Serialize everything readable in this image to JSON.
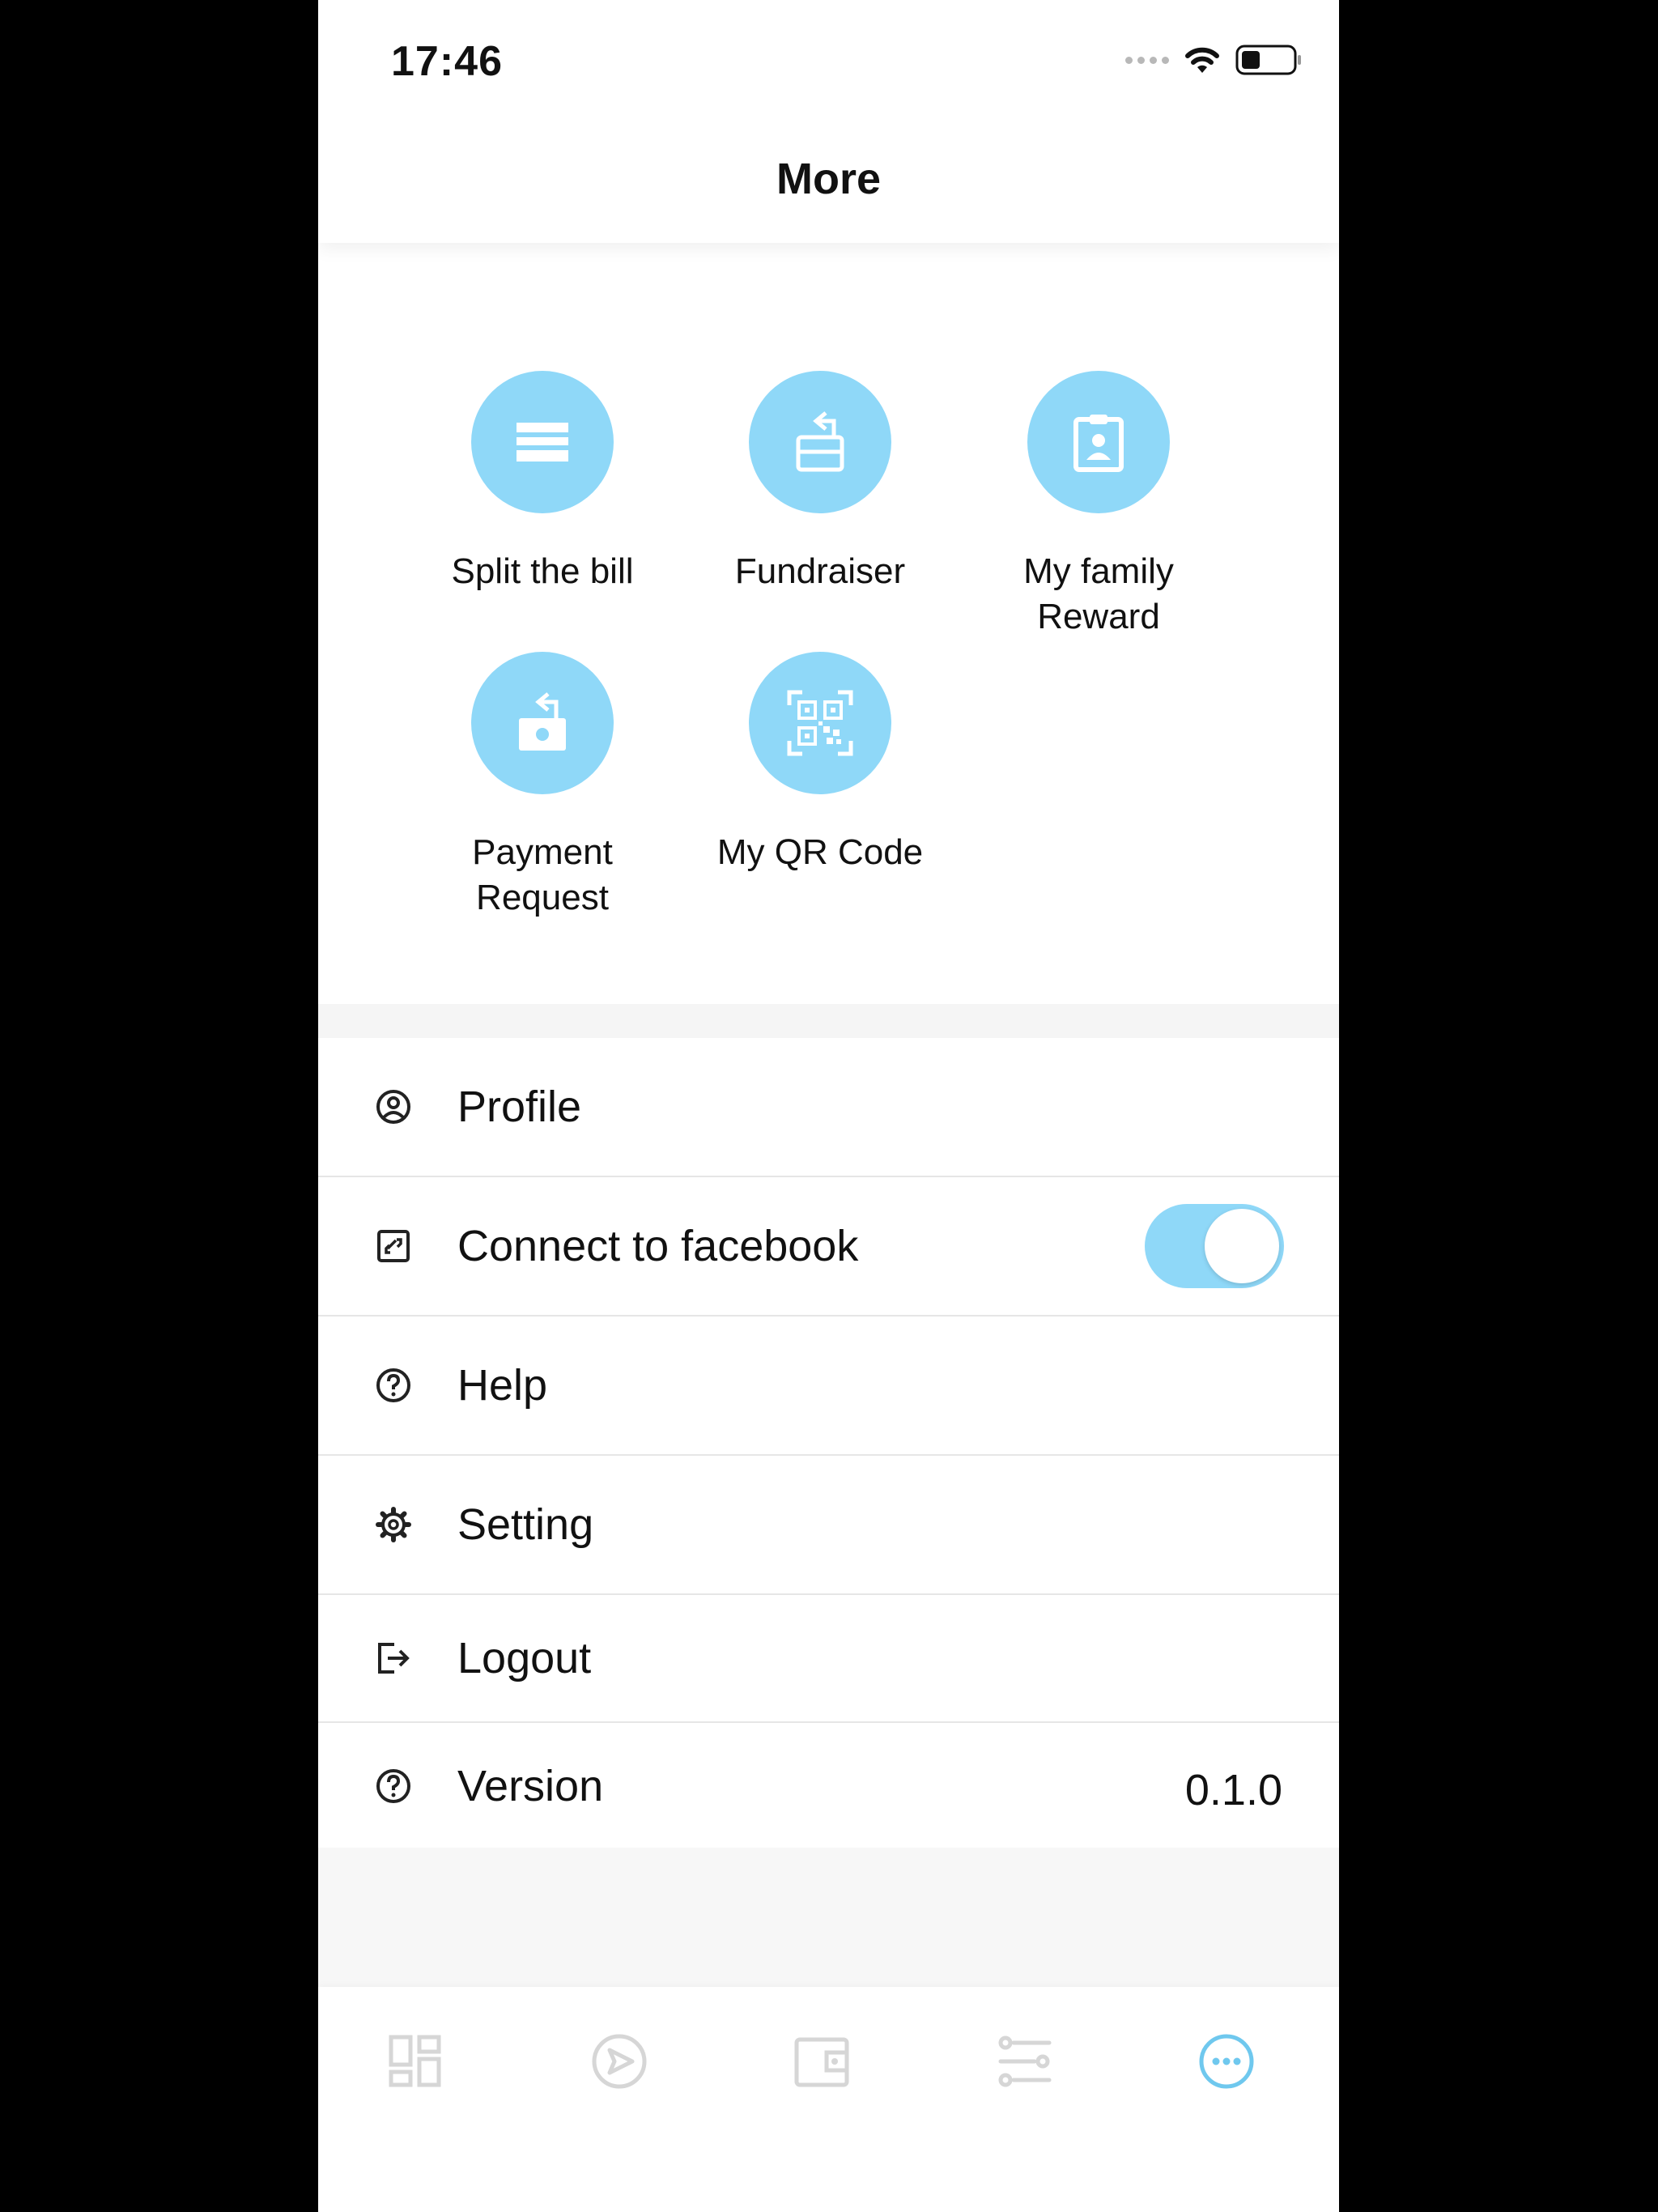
{
  "status_bar": {
    "time": "17:46"
  },
  "header": {
    "title": "More"
  },
  "features": [
    {
      "label": "Split the bill",
      "icon": "card-icon"
    },
    {
      "label": "Fundraiser",
      "icon": "wallet-return-icon"
    },
    {
      "label": "My family\nReward",
      "icon": "id-badge-icon"
    },
    {
      "label": "Payment\nRequest",
      "icon": "cash-return-icon"
    },
    {
      "label": "My QR Code",
      "icon": "qr-code-icon"
    }
  ],
  "settings": {
    "profile": "Profile",
    "facebook": "Connect to facebook",
    "facebook_enabled": true,
    "help": "Help",
    "setting": "Setting",
    "logout": "Logout",
    "version_label": "Version",
    "version_value": "0.1.0"
  },
  "tabbar": {
    "items": [
      "dashboard-icon",
      "send-icon",
      "wallet-icon",
      "transactions-icon",
      "more-icon"
    ],
    "active_index": 4
  },
  "colors": {
    "accent": "#8fd8f8",
    "active_tab": "#6fc8ee",
    "inactive_tab": "#d6d6d6"
  }
}
